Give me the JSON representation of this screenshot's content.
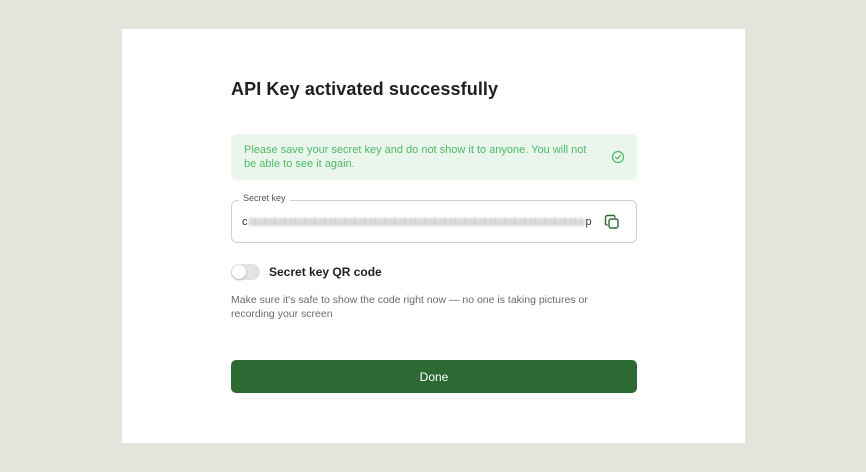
{
  "dialog": {
    "title": "API Key activated successfully",
    "notice": {
      "text": "Please save your secret key and do not show it to anyone. You will not be able to see it again.",
      "icon": "check-circle-icon",
      "color": "#4fb86a",
      "background": "#eaf6ec"
    },
    "secret_key": {
      "label": "Secret key",
      "value_start": "c",
      "value_end": "p",
      "copy_icon": "copy-icon"
    },
    "qr_toggle": {
      "label": "Secret key QR code",
      "checked": false
    },
    "hint": "Make sure it's safe to show the code right now — no one is taking pictures or recording your screen",
    "done_label": "Done",
    "accent": "#2d6a33"
  }
}
